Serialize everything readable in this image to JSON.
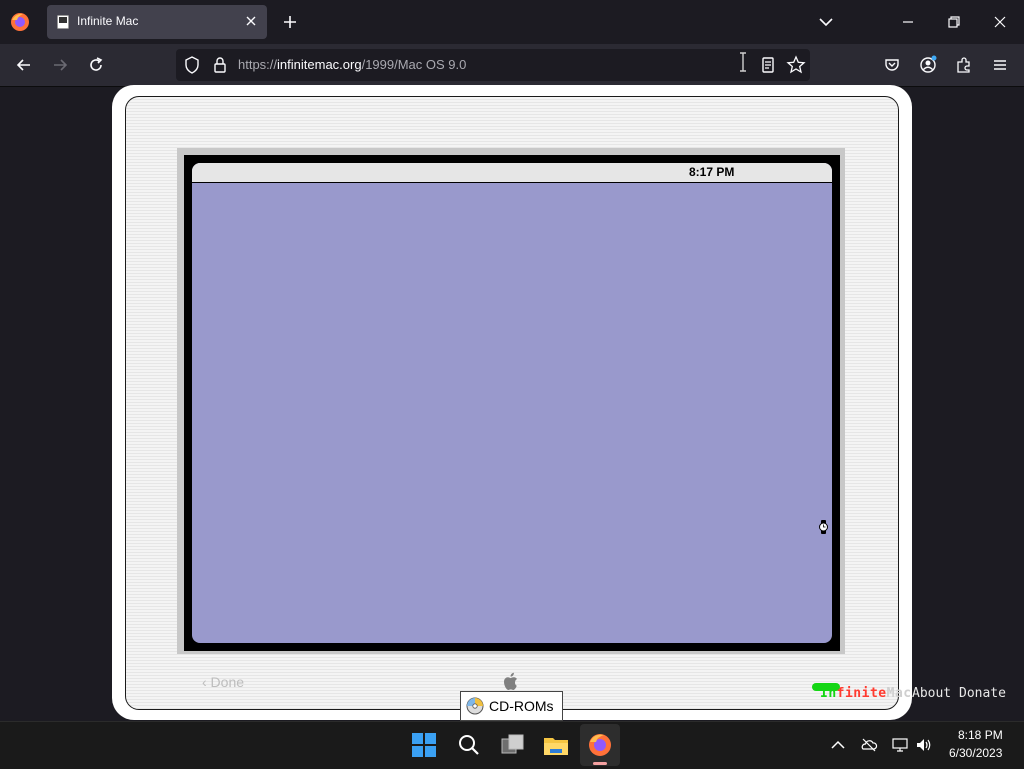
{
  "browser": {
    "tab_title": "Infinite Mac",
    "url_prefix": "https://",
    "url_domain": "infinitemac.org",
    "url_path": "/1999/Mac OS 9.0"
  },
  "emulator": {
    "menubar_clock": "8:17 PM",
    "desktop_color": "#9999cc",
    "done_label": "‹ Done",
    "cdrom_label": "CD-ROMs",
    "logo_text": [
      "In",
      "finite",
      "Mac"
    ],
    "logo_colors": [
      "#14d614",
      "#ff3b30",
      "#3b3bd6"
    ],
    "about_label": "About",
    "donate_label": "Donate"
  },
  "taskbar": {
    "time": "8:18 PM",
    "date": "6/30/2023"
  }
}
